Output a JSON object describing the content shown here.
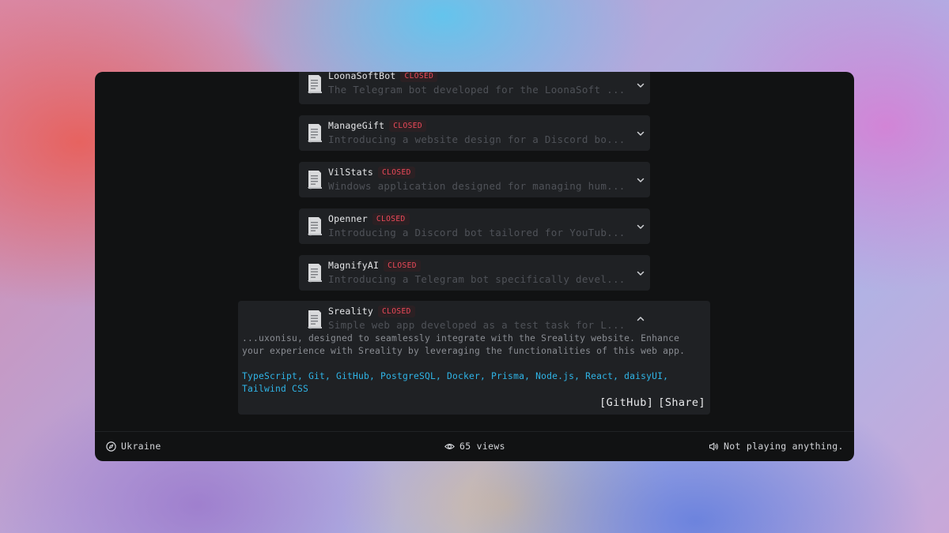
{
  "projects": [
    {
      "name": "LoonaSoftBot",
      "status": "CLOSED",
      "description": "The Telegram bot developed for the LoonaSoft ..."
    },
    {
      "name": "ManageGift",
      "status": "CLOSED",
      "description": "Introducing a website design for a Discord bo..."
    },
    {
      "name": "VilStats",
      "status": "CLOSED",
      "description": "Windows application designed for managing hum..."
    },
    {
      "name": "Openner",
      "status": "CLOSED",
      "description": "Introducing a Discord bot tailored for YouTub..."
    },
    {
      "name": "MagnifyAI",
      "status": "CLOSED",
      "description": "Introducing a Telegram bot specifically devel..."
    },
    {
      "name": "Sreality",
      "status": "CLOSED",
      "description": "Simple web app developed as a test task for L...",
      "details": "...uxonisu, designed to seamlessly integrate with the Sreality website. Enhance your experience with Sreality by leveraging the functionalities of this web app.",
      "technologies": "TypeScript, Git, GitHub, PostgreSQL, Docker, Prisma, Node.js, React, daisyUI, Tailwind CSS",
      "links": {
        "github": "[GitHub]",
        "share": "[Share]"
      }
    }
  ],
  "footer": {
    "location": "Ukraine",
    "views": "65 views",
    "music": "Not playing anything."
  },
  "colors": {
    "badge_text": "#ef4a5a",
    "tech_text": "#2fb4e6",
    "card_bg": "#1f2124",
    "window_bg": "#111213"
  }
}
